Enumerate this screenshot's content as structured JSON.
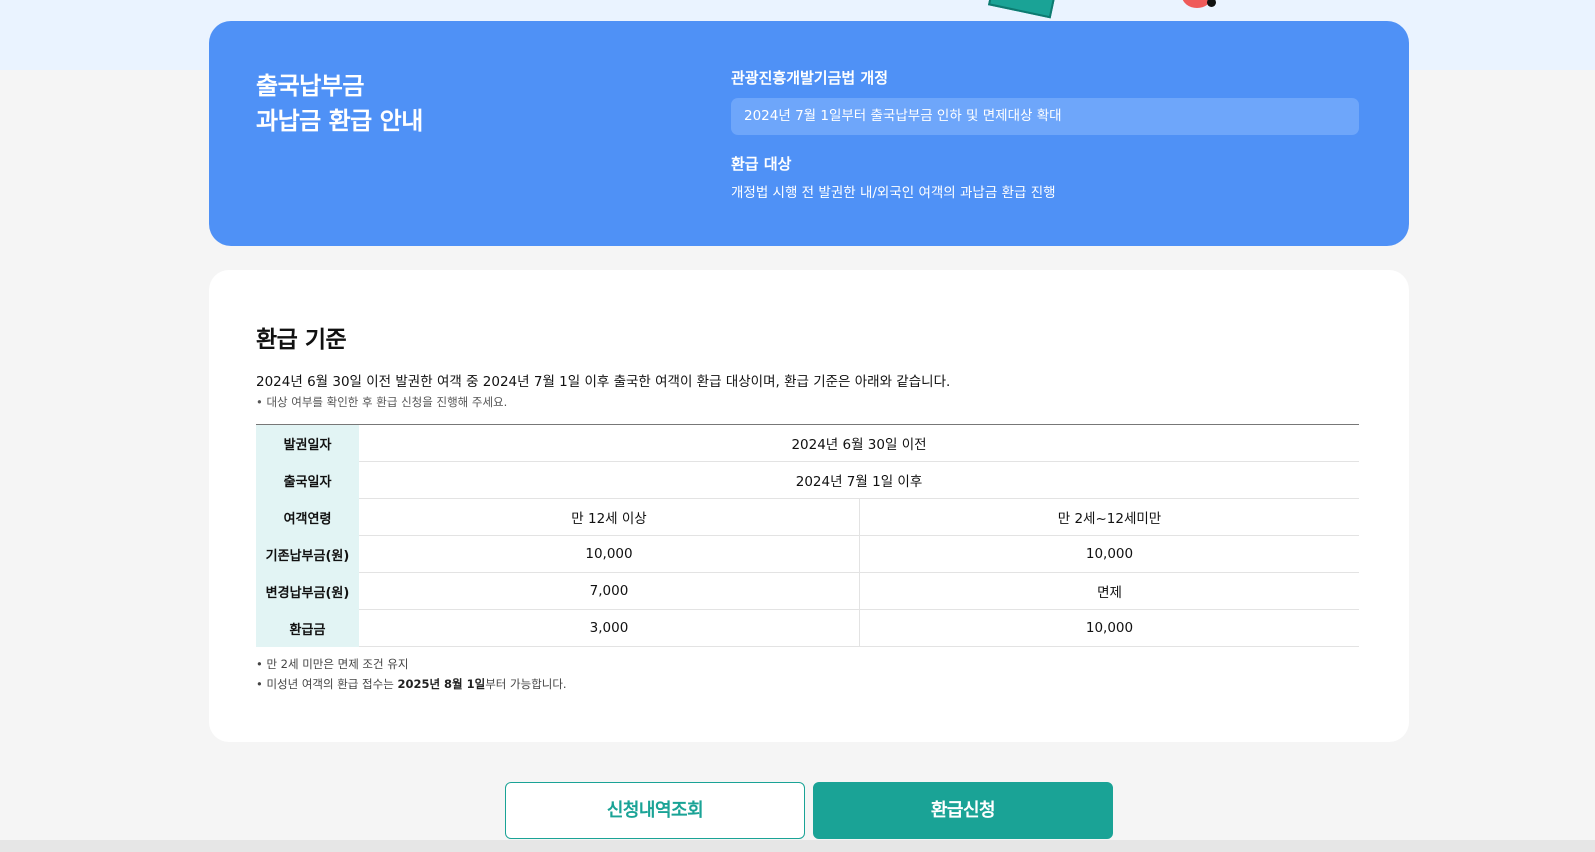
{
  "hero": {
    "title_line1": "출국납부금",
    "title_line2": "과납금 환급 안내",
    "law_title": "관광진흥개발기금법 개정",
    "law_text": "2024년 7월 1일부터 출국납부금 인하 및 면제대상 확대",
    "target_title": "환급 대상",
    "target_text": "개정법 시행 전 발권한 내/외국인 여객의 과납금 환급 진행"
  },
  "criteria": {
    "title": "환급 기준",
    "description": "2024년 6월 30일 이전 발권한 여객 중 2024년 7월 1일 이후 출국한 여객이 환급 대상이며, 환급 기준은 아래와 같습니다.",
    "note": "• 대상 여부를 확인한 후 환급 신청을 진행해 주세요.",
    "table": {
      "rows": [
        {
          "header": "발권일자",
          "merged": "2024년 6월 30일 이전"
        },
        {
          "header": "출국일자",
          "merged": "2024년 7월 1일 이후"
        },
        {
          "header": "여객연령",
          "col1": "만 12세 이상",
          "col2": "만 2세~12세미만"
        },
        {
          "header": "기존납부금(원)",
          "col1": "10,000",
          "col2": "10,000"
        },
        {
          "header": "변경납부금(원)",
          "col1": "7,000",
          "col2": "면제"
        },
        {
          "header": "환급금",
          "col1": "3,000",
          "col2": "10,000"
        }
      ]
    },
    "footnote1": "• 만 2세 미만은 면제 조건 유지",
    "footnote2_prefix": "• 미성년 여객의 환급 접수는 ",
    "footnote2_bold": "2025년 8월 1일",
    "footnote2_suffix": "부터 가능합니다."
  },
  "buttons": {
    "history": "신청내역조회",
    "apply": "환급신청"
  },
  "colors": {
    "hero_bg": "#4f91f6",
    "accent": "#1aa396",
    "table_header_bg": "#e2f4f4"
  }
}
